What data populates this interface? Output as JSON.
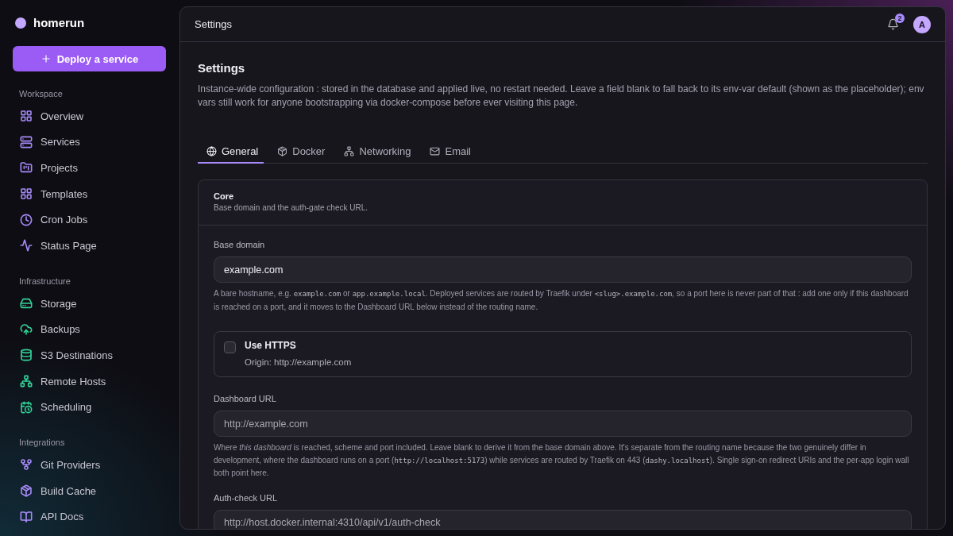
{
  "brand": {
    "name": "homerun"
  },
  "deploy_button": {
    "label": "Deploy a service"
  },
  "sidebar": {
    "groups": [
      {
        "title": "Workspace",
        "color": "#a78bfa",
        "items": [
          {
            "label": "Overview"
          },
          {
            "label": "Services"
          },
          {
            "label": "Projects"
          },
          {
            "label": "Templates"
          },
          {
            "label": "Cron Jobs"
          },
          {
            "label": "Status Page"
          }
        ]
      },
      {
        "title": "Infrastructure",
        "color": "#34d399",
        "items": [
          {
            "label": "Storage"
          },
          {
            "label": "Backups"
          },
          {
            "label": "S3 Destinations"
          },
          {
            "label": "Remote Hosts"
          },
          {
            "label": "Scheduling"
          }
        ]
      },
      {
        "title": "Integrations",
        "color": "#a78bfa",
        "items": [
          {
            "label": "Git Providers"
          },
          {
            "label": "Build Cache"
          },
          {
            "label": "API Docs"
          }
        ]
      }
    ]
  },
  "topbar": {
    "title": "Settings",
    "notifications": "2",
    "avatar": "A"
  },
  "page": {
    "title": "Settings",
    "description": "Instance-wide configuration : stored in the database and applied live, no restart needed. Leave a field blank to fall back to its env-var default (shown as the placeholder); env vars still work for anyone bootstrapping via docker-compose before ever visiting this page."
  },
  "tabs": [
    {
      "label": "General",
      "selected": true
    },
    {
      "label": "Docker",
      "selected": false
    },
    {
      "label": "Networking",
      "selected": false
    },
    {
      "label": "Email",
      "selected": false
    }
  ],
  "section": {
    "title": "Core",
    "subtitle": "Base domain and the auth-gate check URL.",
    "fields": [
      {
        "kind": "input",
        "label": "Base domain",
        "value": "example.com",
        "hint": [
          {
            "kind": "text",
            "text": "A bare hostname, e.g. "
          },
          {
            "kind": "code",
            "text": "example.com"
          },
          {
            "kind": "text",
            "text": " or "
          },
          {
            "kind": "code",
            "text": "app.example.local"
          },
          {
            "kind": "text",
            "text": ". Deployed services are routed by Traefik under "
          },
          {
            "kind": "code",
            "text": "<slug>.example.com"
          },
          {
            "kind": "text",
            "text": ", so a port here is never part of that : add one only if this dashboard is reached on a port, and it moves to the Dashboard URL below instead of the routing name."
          }
        ]
      },
      {
        "kind": "checkbox",
        "label": "Use HTTPS",
        "checked": false,
        "detail": "Origin: http://example.com"
      },
      {
        "kind": "input",
        "label": "Dashboard URL",
        "placeholder": "http://example.com",
        "hint": [
          {
            "kind": "text",
            "text": "Where "
          },
          {
            "kind": "em",
            "text": "this dashboard"
          },
          {
            "kind": "text",
            "text": " is reached, scheme and port included. Leave blank to derive it from the base domain above. It's separate from the routing name because the two genuinely differ in development, where the dashboard runs on a port ("
          },
          {
            "kind": "code",
            "text": "http://localhost:5173"
          },
          {
            "kind": "text",
            "text": ") while services are routed by Traefik on 443 ("
          },
          {
            "kind": "code",
            "text": "dashy.localhost"
          },
          {
            "kind": "text",
            "text": "). Single sign-on redirect URIs and the per-app login wall both point here."
          }
        ]
      },
      {
        "kind": "input",
        "label": "Auth-check URL",
        "placeholder": "http://host.docker.internal:4310/api/v1/auth-check"
      }
    ]
  }
}
